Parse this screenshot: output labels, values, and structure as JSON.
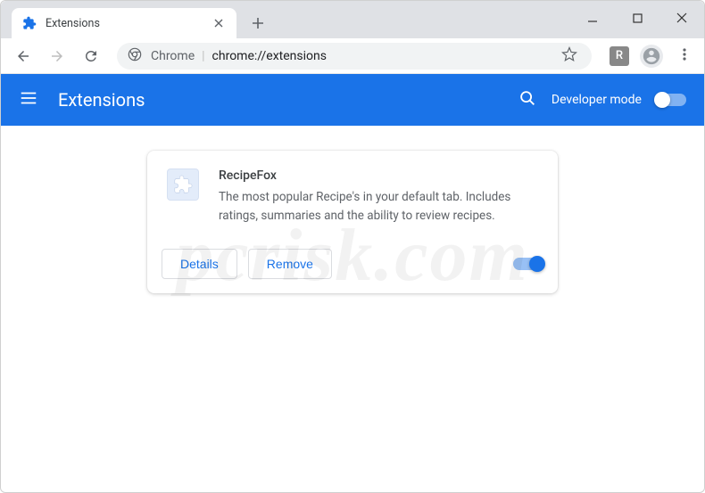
{
  "tab": {
    "title": "Extensions"
  },
  "omnibox": {
    "prefix": "Chrome",
    "url": "chrome://extensions"
  },
  "toolbar": {
    "ext_badge": "R"
  },
  "header": {
    "title": "Extensions",
    "devmode_label": "Developer mode"
  },
  "extension": {
    "name": "RecipeFox",
    "description": "The most popular Recipe's in your default tab. Includes ratings, summaries and the ability to review recipes.",
    "details_label": "Details",
    "remove_label": "Remove"
  },
  "watermark": "pcrisk.com"
}
